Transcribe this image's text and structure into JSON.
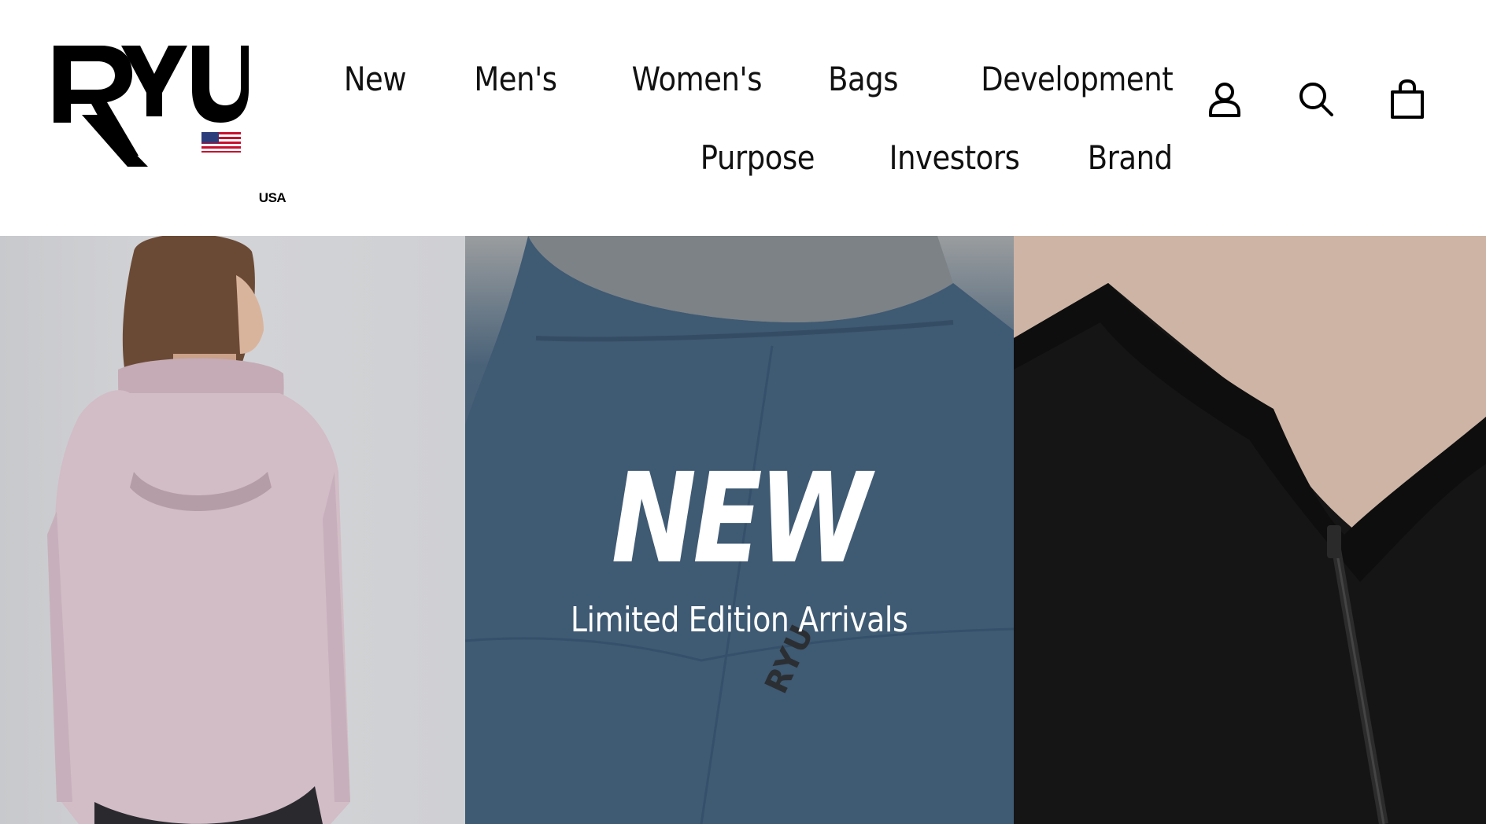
{
  "brand": {
    "logo_text": "RYU",
    "flag_label": "USA"
  },
  "nav": {
    "row1": [
      "New",
      "Men's",
      "Women's",
      "Bags",
      "Development"
    ],
    "row2": [
      "Purpose",
      "Investors",
      "Brand"
    ]
  },
  "icons": [
    "account-icon",
    "search-icon",
    "cart-icon"
  ],
  "hero": {
    "title": "NEW",
    "subtitle": "Limited Edition Arrivals"
  },
  "colors": {
    "text": "#111111",
    "hero_text": "#ffffff",
    "mid_panel_blue": "#3f5a73",
    "left_panel_grey": "#cfd0d3",
    "right_panel_black": "#111111"
  }
}
